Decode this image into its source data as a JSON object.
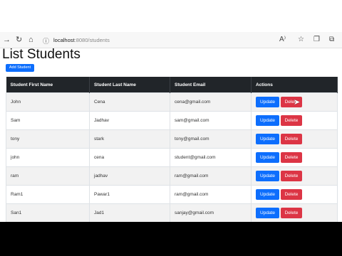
{
  "browser": {
    "url_host": "localhost",
    "url_path": ":8080/students"
  },
  "page": {
    "title": "List Students",
    "add_button": "Add Student"
  },
  "table": {
    "headers": [
      "Student First Name",
      "Student Last Name",
      "Student Email",
      "Actions"
    ],
    "update_label": "Update",
    "delete_label": "Delete",
    "rows": [
      {
        "first": "John",
        "last": "Cena",
        "email": "cena@gmail.com"
      },
      {
        "first": "Sam",
        "last": "Jadhav",
        "email": "sam@gmail.com"
      },
      {
        "first": "tony",
        "last": "stark",
        "email": "tony@gmail.com"
      },
      {
        "first": "john",
        "last": "cena",
        "email": "student@gmail.com"
      },
      {
        "first": "ram",
        "last": "jadhav",
        "email": "ram@gmail.com"
      },
      {
        "first": "Ram1",
        "last": "Pawar1",
        "email": "ram@gmail.com"
      },
      {
        "first": "San1",
        "last": "Jad1",
        "email": "sanjay@gmail.com"
      }
    ]
  },
  "icons": {
    "back": "back-arrow-icon",
    "home": "home-icon",
    "info": "site-info-icon",
    "read_aloud": "read-aloud-icon",
    "favorite": "favorite-star-icon",
    "collections": "collections-icon"
  }
}
